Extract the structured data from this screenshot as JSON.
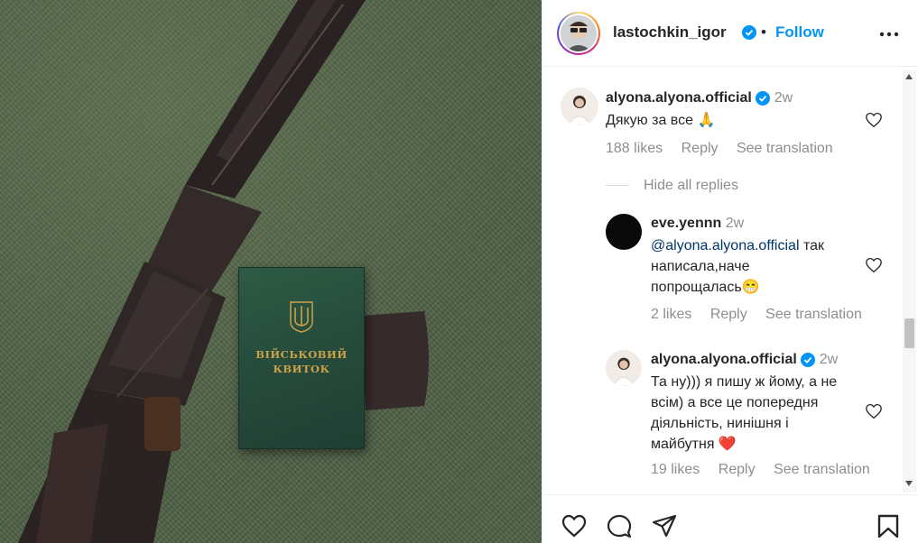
{
  "photo": {
    "ticket_line1": "ВІЙСЬКОВИЙ",
    "ticket_line2": "КВИТОК"
  },
  "header": {
    "username": "lastochkin_igor",
    "separator": "•",
    "follow_label": "Follow"
  },
  "comments": [
    {
      "username": "alyona.alyona.official",
      "time": "2w",
      "text": "Дякую за все 🙏",
      "likes": "188 likes",
      "reply": "Reply",
      "see_translation": "See translation"
    }
  ],
  "hide_replies": "Hide all replies",
  "replies": [
    {
      "username": "eve.yennn",
      "time": "2w",
      "mention": "@alyona.alyona.official",
      "text_line1_rest": " так",
      "text_line2": "написала,наче",
      "text_line3": "попрощалась😁",
      "likes": "2 likes",
      "reply": "Reply",
      "see_translation": "See translation"
    },
    {
      "username": "alyona.alyona.official",
      "time": "2w",
      "text_line1": "Та ну))) я пишу ж йому, а не",
      "text_line2": "всім) а все це попередня",
      "text_line3": "діяльність, нинішня і",
      "text_line4": "майбутня ❤️",
      "likes": "19 likes",
      "reply": "Reply",
      "see_translation": "See translation"
    }
  ],
  "icons": {
    "verified": "verified-badge-icon",
    "more": "more-options-icon",
    "heart": "heart-icon",
    "comment": "comment-icon",
    "share": "share-icon",
    "save": "bookmark-icon"
  },
  "colors": {
    "link_blue": "#0095f6",
    "verified_blue": "#0095f6",
    "secondary_text": "#8e8e8e",
    "mention": "#00376b"
  }
}
